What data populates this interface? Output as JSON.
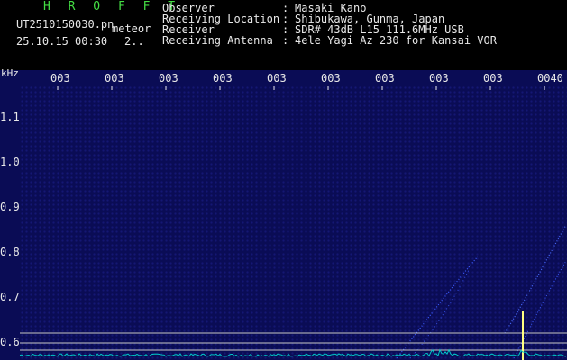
{
  "header": {
    "title": "H R O F F T",
    "filename": "UT2510150030.pn",
    "meteor_label": "meteor",
    "datetime": "25.10.15 00:30",
    "count": "2..",
    "info": [
      {
        "key": "Observer",
        "value": "Masaki Kano"
      },
      {
        "key": "Receiving Location",
        "value": "Shibukawa, Gunma, Japan"
      },
      {
        "key": "Receiver",
        "value": "SDR# 43dB L15 111.6MHz USB"
      },
      {
        "key": "Receiving Antenna",
        "value": "4ele Yagi Az 230 for Kansai VOR"
      }
    ]
  },
  "axis": {
    "unit": "kHz",
    "x_ticks": [
      "003",
      "003",
      "003",
      "003",
      "003",
      "003",
      "003",
      "003",
      "003",
      "0040"
    ],
    "y_ticks": [
      "1.1",
      "1.0",
      "0.9",
      "0.8",
      "0.7",
      "0.6"
    ]
  },
  "colors": {
    "background": "#0a0c55",
    "header_green": "#44dd44",
    "text": "#e8e8e8",
    "trace": "#4a6cff",
    "reference_line": "#c8c8c8",
    "noise": "#00c8c8",
    "echo": "#ffff80"
  }
}
